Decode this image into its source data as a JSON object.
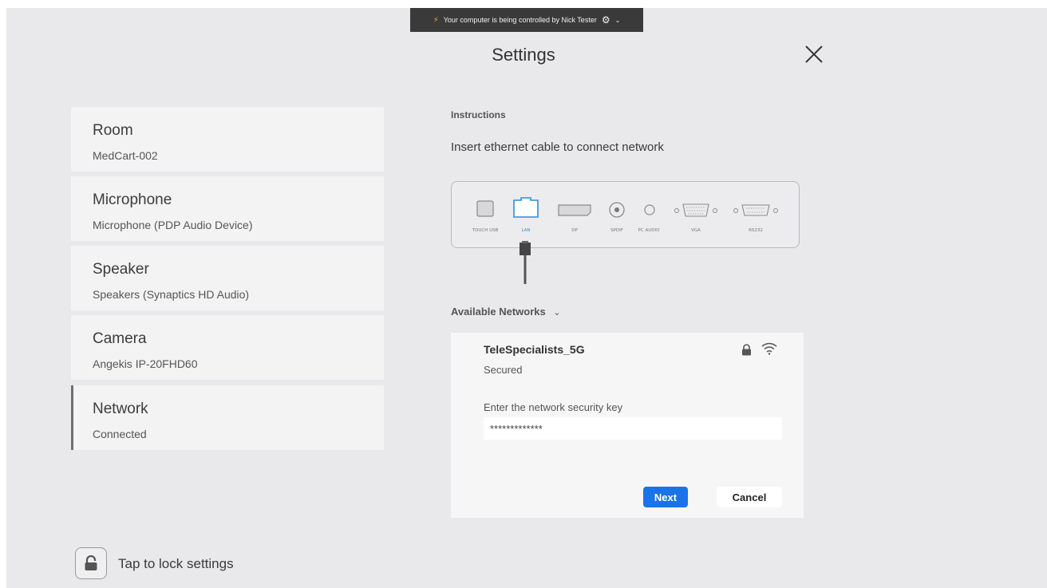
{
  "banner": {
    "text": "Your computer is being controlled by Nick Tester"
  },
  "header": {
    "title": "Settings"
  },
  "menu": [
    {
      "title": "Room",
      "subtitle": "MedCart-002"
    },
    {
      "title": "Microphone",
      "subtitle": "Microphone (PDP Audio Device)"
    },
    {
      "title": "Speaker",
      "subtitle": "Speakers (Synaptics HD Audio)"
    },
    {
      "title": "Camera",
      "subtitle": "Angekis IP-20FHD60"
    },
    {
      "title": "Network",
      "subtitle": "Connected",
      "active": true
    }
  ],
  "lock": {
    "label": "Tap to lock settings"
  },
  "instructions": {
    "heading": "Instructions",
    "text": "Insert ethernet cable to connect network"
  },
  "ports": {
    "touch_usb": "TOUCH USB",
    "lan": "LAN",
    "dp": "DP",
    "spdif": "SPDIF",
    "pc_audio": "PC AUDIO",
    "vga": "VGA",
    "rs232": "RS232"
  },
  "networks": {
    "heading": "Available Networks",
    "ssid": "TeleSpecialists_5G",
    "status": "Secured",
    "key_label": "Enter the network security key",
    "key_value": "*************",
    "next_label": "Next",
    "cancel_label": "Cancel"
  },
  "colors": {
    "background": "#e9e9eb",
    "card": "#f3f3f4",
    "accent": "#1a73e8",
    "lan_highlight": "#2b8fd6"
  }
}
